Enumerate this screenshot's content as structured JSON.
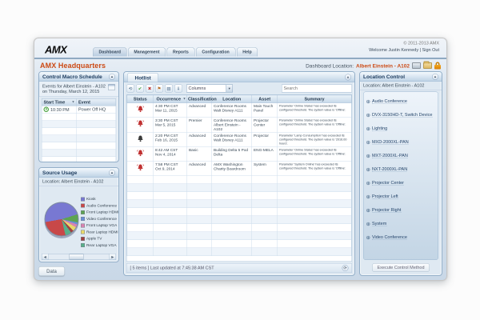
{
  "window": {
    "copyright": "© 2011-2013 AMX",
    "logo": "AMX",
    "welcome": "Welcome Justin Kennedy",
    "separator": "|",
    "sign_out": "Sign Out",
    "tabs": [
      {
        "label": "Dashboard"
      },
      {
        "label": "Management"
      },
      {
        "label": "Reports"
      },
      {
        "label": "Configuration"
      },
      {
        "label": "Help"
      }
    ]
  },
  "titlebar": {
    "title": "AMX Headquarters",
    "location_label": "Dashboard Location:",
    "location_value": "Albert Einstein - A102"
  },
  "macro_panel": {
    "title": "Control Macro Schedule",
    "info_line1": "Events for Albert Einstein - A102",
    "info_line2": "on Thursday, March 12, 2015",
    "col_start_time": "Start Time",
    "col_event": "Event",
    "rows": [
      {
        "start_time": "10:30 PM",
        "event": "Power Off HQ"
      }
    ]
  },
  "usage_panel": {
    "title": "Source Usage",
    "location_label": "Location:",
    "location_value": "Albert Einstein - A102",
    "data_button": "Data"
  },
  "chart_data": {
    "type": "pie",
    "title": "Source Usage",
    "labels": [
      "Kiosk",
      "Audio Conference",
      "Front Laptop HDMI",
      "Video Conference",
      "Front Laptop VGA",
      "Rear Laptop HDMI",
      "Apple TV",
      "Rear Laptop VGA"
    ],
    "values": [
      48,
      26,
      8,
      2,
      3,
      4,
      3,
      6
    ],
    "colors": [
      "#7878d2",
      "#c84848",
      "#5ea352",
      "#6a8fd8",
      "#d884b0",
      "#e8d86a",
      "#a04040",
      "#58b08a"
    ],
    "slice_order": [
      0,
      2,
      3,
      4,
      5,
      6,
      7,
      1
    ],
    "start_angle_deg": 260,
    "legend_position": "right"
  },
  "hotlist": {
    "title": "Hotlist",
    "columns_dropdown": "Columns",
    "search_placeholder": "Search",
    "columns": [
      "Status",
      "Occurrence",
      "Classification",
      "Location",
      "Asset",
      "Summary"
    ],
    "status_bar": "[ 5 items ]   Last updated at 7:45:38 AM CST",
    "rows": [
      {
        "status": "alert-red",
        "time": "4:30 PM CST",
        "date": "Mar 11, 2015",
        "classification": "Advanced",
        "location": "Conference Rooms Walt Disney A111",
        "asset": "Main Touch Panel",
        "summary": "Parameter 'Online Status' has exceeded its configured threshold. The system value is 'Offline'."
      },
      {
        "status": "alert-red",
        "time": "3:30 PM CST",
        "date": "Mar 5, 2015",
        "classification": "Premier",
        "location": "Conference Rooms Albert Einstein - A102",
        "asset": "Projector Center",
        "summary": "Parameter 'Online Status' has exceeded its configured threshold. The system value is 'Offline'."
      },
      {
        "status": "alert-dark",
        "time": "2:20 PM CST",
        "date": "Feb 16, 2015",
        "classification": "Advanced",
        "location": "Conference Rooms Walt Disney A111",
        "asset": "Projector",
        "summary": "Parameter 'Lamp Consumption' has exceeded its configured threshold. The system value is '2016.00 hours'."
      },
      {
        "status": "alert-red",
        "time": "8:42 AM CST",
        "date": "Nov 4, 2014",
        "classification": "Basic",
        "location": "Building Delta 5 Pod Delta",
        "asset": "ENG-MELA",
        "summary": "Parameter 'Online Status' has exceeded its configured threshold. The system value is 'Offline'."
      },
      {
        "status": "alert-red",
        "time": "7:58 PM CST",
        "date": "Oct 9, 2014",
        "classification": "Advanced",
        "location": "AMX Washington Charity Boardroom",
        "asset": "System",
        "summary": "Parameter 'System Online' has exceeded its configured threshold. The system value is 'Offline'."
      }
    ]
  },
  "location_control": {
    "title": "Location Control",
    "location_label": "Location:",
    "location_value": "Albert Einstein - A102",
    "items": [
      "Audio Conference",
      "DVX-3150HD-T, Switch Device",
      "Lighting",
      "MXD-2000XL-PAN",
      "MXT-2000XL-PAN",
      "NXT-2000XL-PAN",
      "Projector Center",
      "Projector Left",
      "Projector Right",
      "System",
      "Video Conference"
    ],
    "execute_button": "Execute Control Method"
  },
  "icons": {
    "collapse": "▲",
    "dropdown_arrow": "▼",
    "sort": "▼",
    "scroll_left": "◀",
    "scroll_right": "▶",
    "plus": "⊕",
    "refresh": "⟳",
    "toolbar": [
      "⟲",
      "✔",
      "✖",
      "⚑",
      "▤",
      "⇓"
    ]
  }
}
